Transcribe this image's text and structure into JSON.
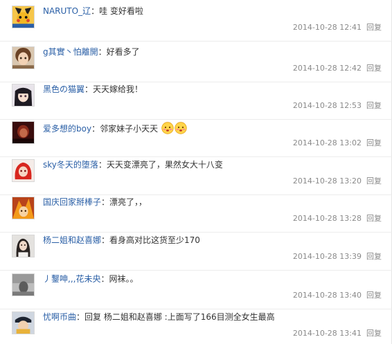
{
  "comments": [
    {
      "user": "NARUTO_辽",
      "sep": "：",
      "text": "哇  变好看啦",
      "time": "2014-10-28 12:41",
      "reply": "回复",
      "avatar": "naruto-pokemon-avatar"
    },
    {
      "user": "g其實丶怕離開",
      "sep": "：",
      "text": "好看多了",
      "time": "2014-10-28 12:42",
      "reply": "回复",
      "avatar": "brown-hair-girl-avatar"
    },
    {
      "user": "黑色の猫翼",
      "sep": "：",
      "text": "天天嫁给我！",
      "time": "2014-10-28 12:53",
      "reply": "回复",
      "avatar": "anime-girl-avatar"
    },
    {
      "user": "爱多想的boy",
      "sep": "：",
      "text": "邻家妹子小天天",
      "time": "2014-10-28 13:02",
      "reply": "回复",
      "avatar": "dark-red-avatar",
      "emojis": [
        "shy-face-emoji",
        "shy-face-emoji"
      ]
    },
    {
      "user": "sky冬天的堕落",
      "sep": "：",
      "text": "天天变漂亮了，果然女大十八变",
      "time": "2014-10-28 13:20",
      "reply": "回复",
      "avatar": "red-hair-avatar"
    },
    {
      "user": "国庆回家掰棒子",
      "sep": "：",
      "text": "漂亮了，，",
      "time": "2014-10-28 13:28",
      "reply": "回复",
      "avatar": "orange-anime-avatar"
    },
    {
      "user": "杨二姐和赵喜娜",
      "sep": "：",
      "text": "看身高对比这货至少170",
      "time": "2014-10-28 13:39",
      "reply": "回复",
      "avatar": "woman-photo-avatar"
    },
    {
      "user": "丿鑋呻,,,花未央",
      "sep": "：",
      "text": "网袜。。",
      "time": "2014-10-28 13:40",
      "reply": "回复",
      "avatar": "grayscale-avatar"
    },
    {
      "user": "忧啊币曲",
      "sep": "：",
      "text": "回复  杨二姐和赵喜娜  :上面写了166目测全女生最高",
      "time": "2014-10-28 13:41",
      "reply": "回复",
      "avatar": "pirate-anime-avatar"
    }
  ]
}
